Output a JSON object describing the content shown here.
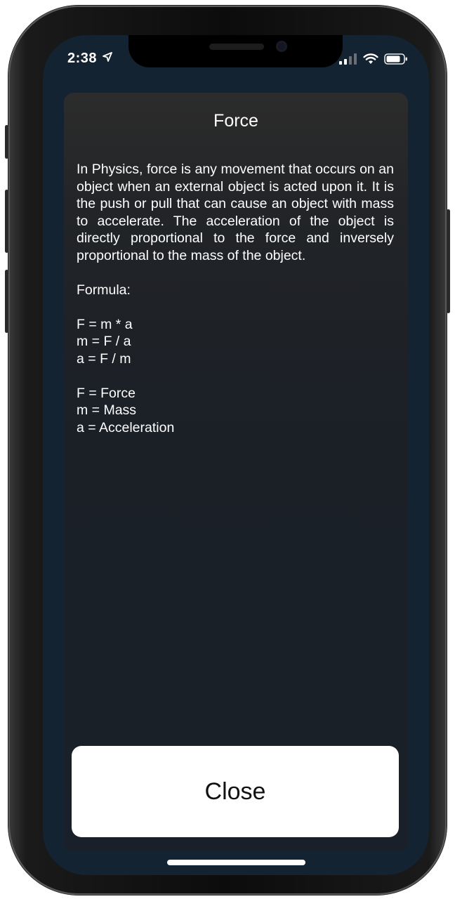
{
  "status_bar": {
    "time": "2:38",
    "icons": [
      "location-arrow-icon",
      "cellular-signal-icon",
      "wifi-icon",
      "battery-icon"
    ]
  },
  "modal": {
    "title": "Force",
    "description": "In Physics, force is any movement that occurs on an object when an external object is acted upon it. It is the push or pull that can cause an object with mass to accelerate. The acceleration of the object is directly proportional to the force and inversely proportional to the mass of the object.",
    "formula_heading": "Formula:",
    "formulas": [
      "F = m * a",
      "m = F / a",
      "a = F / m"
    ],
    "legend": [
      "F = Force",
      "m = Mass",
      "a = Acceleration"
    ],
    "close_label": "Close"
  },
  "colors": {
    "screen_background": "#142331",
    "modal_top": "#2c2c2c",
    "modal_bottom": "#192029",
    "button_background": "#ffffff"
  }
}
